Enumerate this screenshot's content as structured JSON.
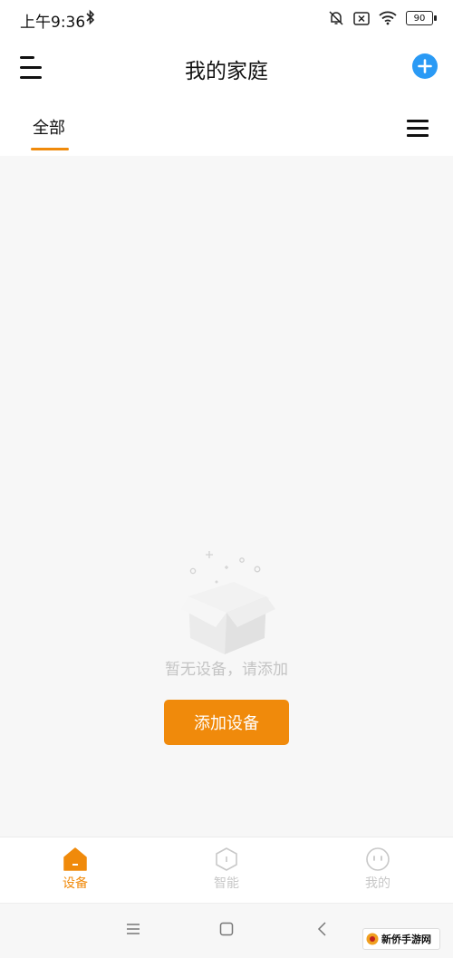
{
  "status_bar": {
    "time": "上午9:36",
    "battery": "90"
  },
  "header": {
    "title": "我的家庭"
  },
  "tabs": [
    {
      "label": "全部",
      "active": true
    }
  ],
  "empty_state": {
    "message": "暂无设备，请添加",
    "button_label": "添加设备"
  },
  "bottom_nav": [
    {
      "label": "设备",
      "icon": "home-icon",
      "active": true
    },
    {
      "label": "智能",
      "icon": "hexagon-smart-icon",
      "active": false
    },
    {
      "label": "我的",
      "icon": "face-profile-icon",
      "active": false
    }
  ],
  "watermark": {
    "text": "新侨手游网"
  },
  "colors": {
    "accent": "#f08a0b",
    "add_button": "#2a9af5",
    "inactive": "#c8c8c8"
  }
}
